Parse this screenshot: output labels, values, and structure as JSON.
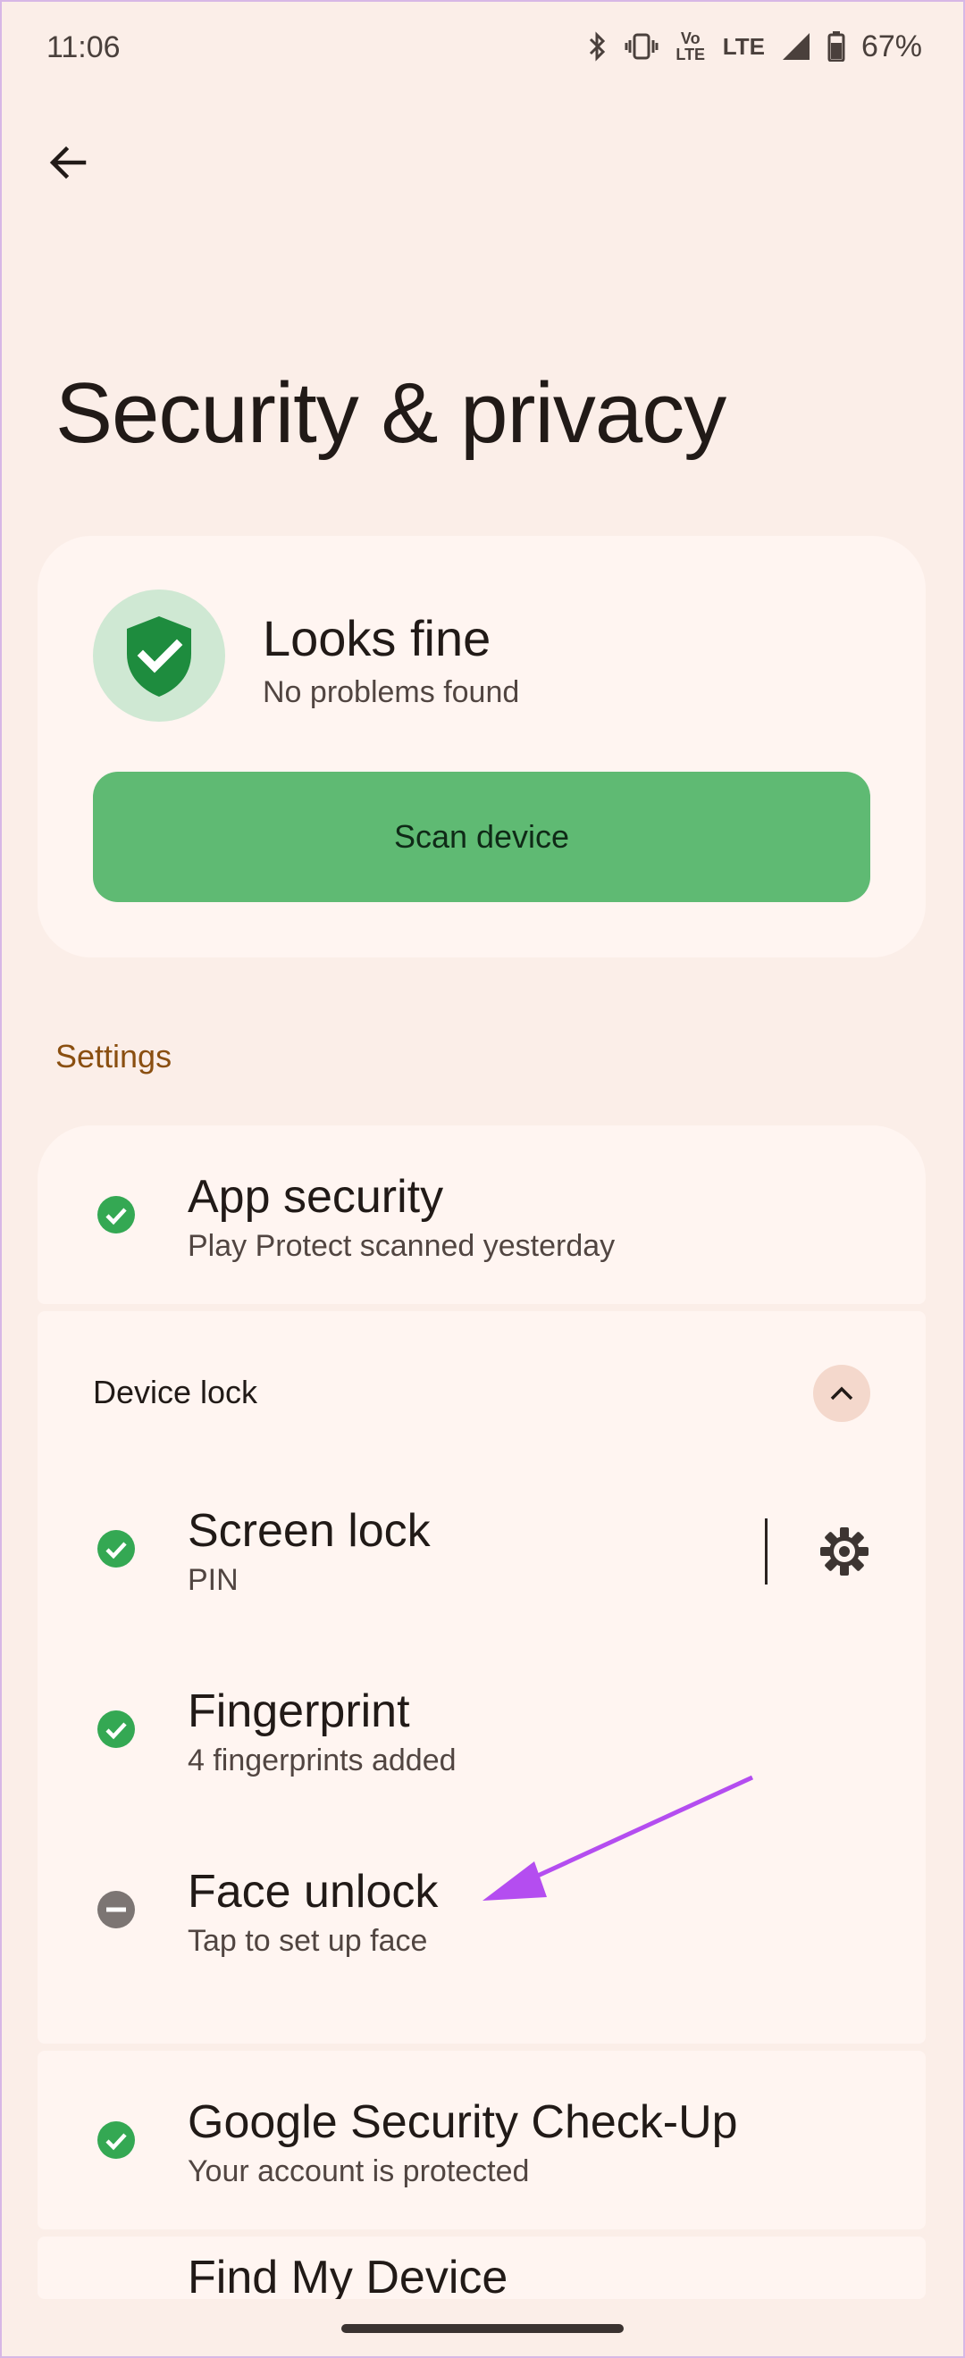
{
  "status_bar": {
    "time": "11:06",
    "volte": "Vo LTE",
    "lte": "LTE",
    "battery": "67%"
  },
  "header": {
    "title": "Security & privacy"
  },
  "status_card": {
    "title": "Looks fine",
    "subtitle": "No problems found",
    "scan_button": "Scan device"
  },
  "settings": {
    "section_label": "Settings",
    "app_security": {
      "title": "App security",
      "subtitle": "Play Protect scanned yesterday"
    },
    "device_lock": {
      "label": "Device lock",
      "items": [
        {
          "title": "Screen lock",
          "subtitle": "PIN"
        },
        {
          "title": "Fingerprint",
          "subtitle": "4 fingerprints added"
        },
        {
          "title": "Face unlock",
          "subtitle": "Tap to set up face"
        }
      ]
    },
    "google_check": {
      "title": "Google Security Check-Up",
      "subtitle": "Your account is protected"
    },
    "find_device": {
      "title": "Find My Device"
    }
  },
  "colors": {
    "background": "#fbeee8",
    "card": "#fff5f1",
    "accent_green": "#5fba73",
    "status_green": "#34a853",
    "status_gray": "#7c7573",
    "section_header": "#8a4f10",
    "annotation_arrow": "#b44df0"
  }
}
